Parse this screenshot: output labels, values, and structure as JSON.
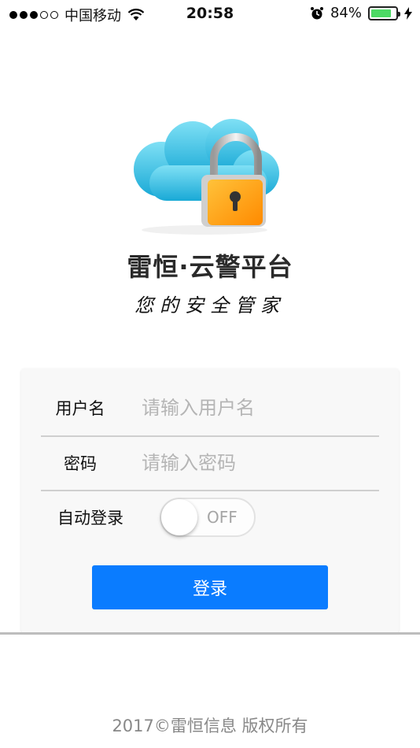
{
  "status_bar": {
    "carrier": "中国移动",
    "time": "20:58",
    "battery_percent": "84%",
    "battery_level": 0.84,
    "battery_color": "#4cd964",
    "signal_strength": 3,
    "icons": [
      "signal-dots-icon",
      "wifi-icon",
      "alarm-icon",
      "battery-icon",
      "charging-icon"
    ]
  },
  "brand": {
    "title": "雷恒·云警平台",
    "slogan": "您的安全管家",
    "logo_icon": "cloud-padlock-icon"
  },
  "login_form": {
    "username_label": "用户名",
    "username_placeholder": "请输入用户名",
    "username_value": "",
    "password_label": "密码",
    "password_placeholder": "请输入密码",
    "password_value": "",
    "auto_login_label": "自动登录",
    "auto_login_state": "OFF",
    "auto_login_on": false,
    "login_button_label": "登录",
    "accent_color": "#0a7cff"
  },
  "footer": {
    "copyright": "2017©雷恒信息 版权所有"
  }
}
